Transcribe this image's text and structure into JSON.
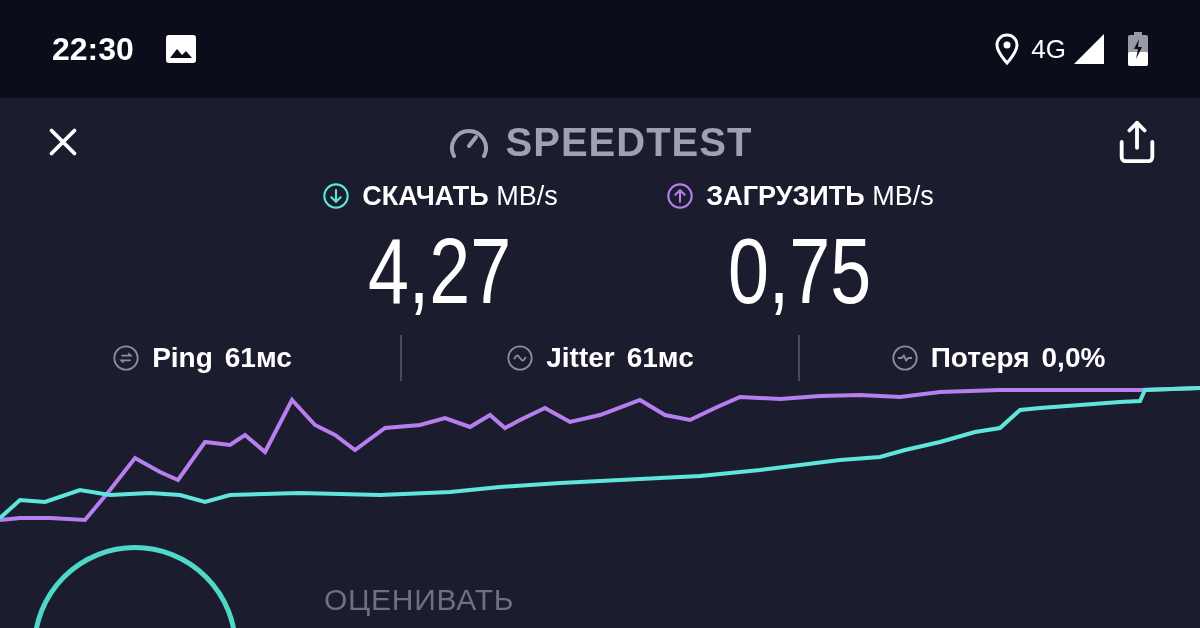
{
  "status_bar": {
    "time": "22:30",
    "network": "4G"
  },
  "header": {
    "title": "SPEEDTEST"
  },
  "metrics": [
    {
      "kind": "download",
      "label": "СКАЧАТЬ",
      "unit": "MB/s",
      "value": "4,27",
      "color": "#5ee6da"
    },
    {
      "kind": "upload",
      "label": "ЗАГРУЗИТЬ",
      "unit": "MB/s",
      "value": "0,75",
      "color": "#b77ef0"
    }
  ],
  "stats": [
    {
      "kind": "ping",
      "label": "Ping",
      "value": "61мс"
    },
    {
      "kind": "jitter",
      "label": "Jitter",
      "value": "61мс"
    },
    {
      "kind": "loss",
      "label": "Потеря",
      "value": "0,0%"
    }
  ],
  "footer": {
    "label": "ОЦЕНИВАТЬ"
  }
}
